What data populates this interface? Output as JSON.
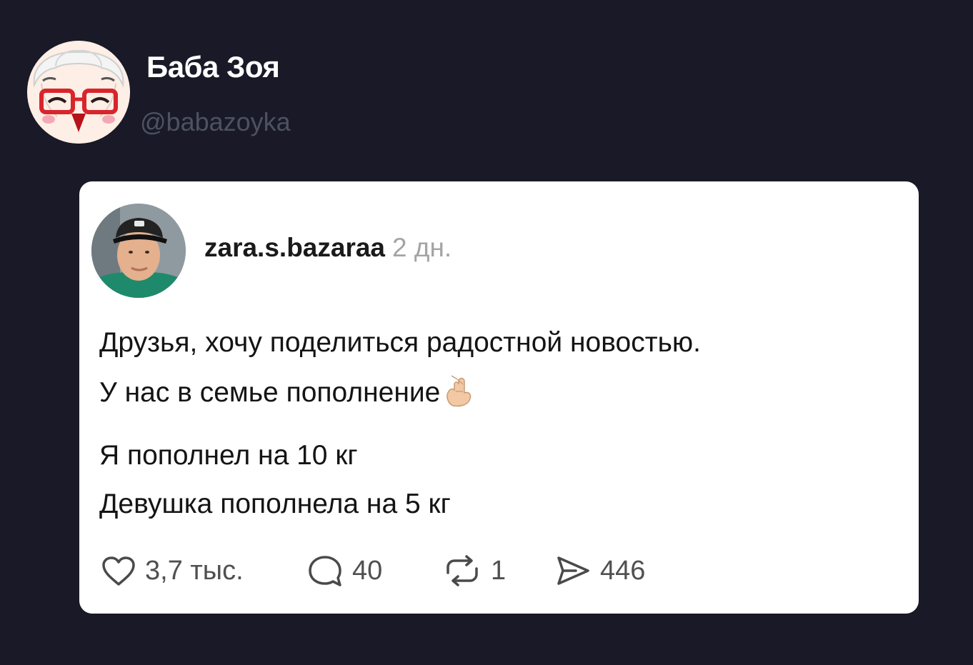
{
  "profile": {
    "name": "Баба Зоя",
    "handle": "@babazoyka",
    "avatar_icon": "cartoon-grandma-avatar"
  },
  "post": {
    "username": "zara.s.bazaraa",
    "time": "2 дн.",
    "avatar_icon": "man-in-cap-photo",
    "paragraph1": [
      "Друзья, хочу поделиться радостной новостью.",
      "У нас в семье пополнение"
    ],
    "emoji_icon": "crossed-fingers-emoji",
    "paragraph2": [
      "Я пополнел на 10 кг",
      "Девушка пополнела на 5 кг"
    ],
    "stats": {
      "likes": "3,7 тыс.",
      "comments": "40",
      "reposts": "1",
      "shares": "446"
    }
  },
  "colors": {
    "page_background": "#191927",
    "card_background": "#ffffff",
    "handle_text": "#4d5260",
    "time_text": "#a4a4a4",
    "stat_text": "#505050"
  }
}
